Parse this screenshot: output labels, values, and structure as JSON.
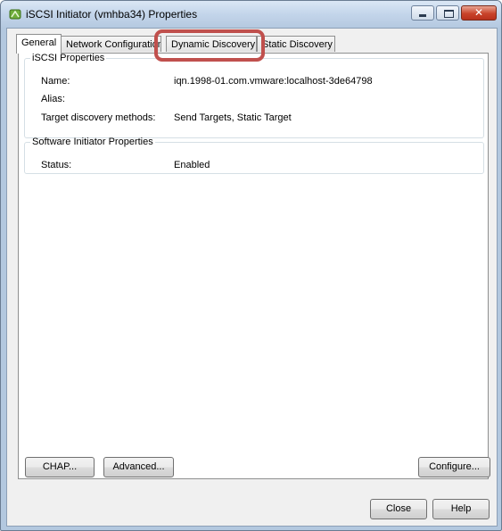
{
  "window": {
    "title": "iSCSI Initiator (vmhba34) Properties",
    "caption_buttons": {
      "minimize": "minimize",
      "maximize": "maximize",
      "close": "✕"
    }
  },
  "tabs": [
    {
      "label": "General",
      "active": true
    },
    {
      "label": "Network Configuration",
      "active": false
    },
    {
      "label": "Dynamic Discovery",
      "active": false,
      "highlighted": true
    },
    {
      "label": "Static Discovery",
      "active": false
    }
  ],
  "iscsi_properties": {
    "title": "iSCSI Properties",
    "name_label": "Name:",
    "name_value": "iqn.1998-01.com.vmware:localhost-3de64798",
    "alias_label": "Alias:",
    "alias_value": "",
    "methods_label": "Target discovery methods:",
    "methods_value": "Send Targets, Static Target"
  },
  "software_initiator": {
    "title": "Software Initiator Properties",
    "status_label": "Status:",
    "status_value": "Enabled"
  },
  "panel_buttons": {
    "chap": "CHAP...",
    "advanced": "Advanced...",
    "configure": "Configure..."
  },
  "dialog_buttons": {
    "close": "Close",
    "help": "Help"
  },
  "colors": {
    "highlight_ring": "#c0504d"
  }
}
